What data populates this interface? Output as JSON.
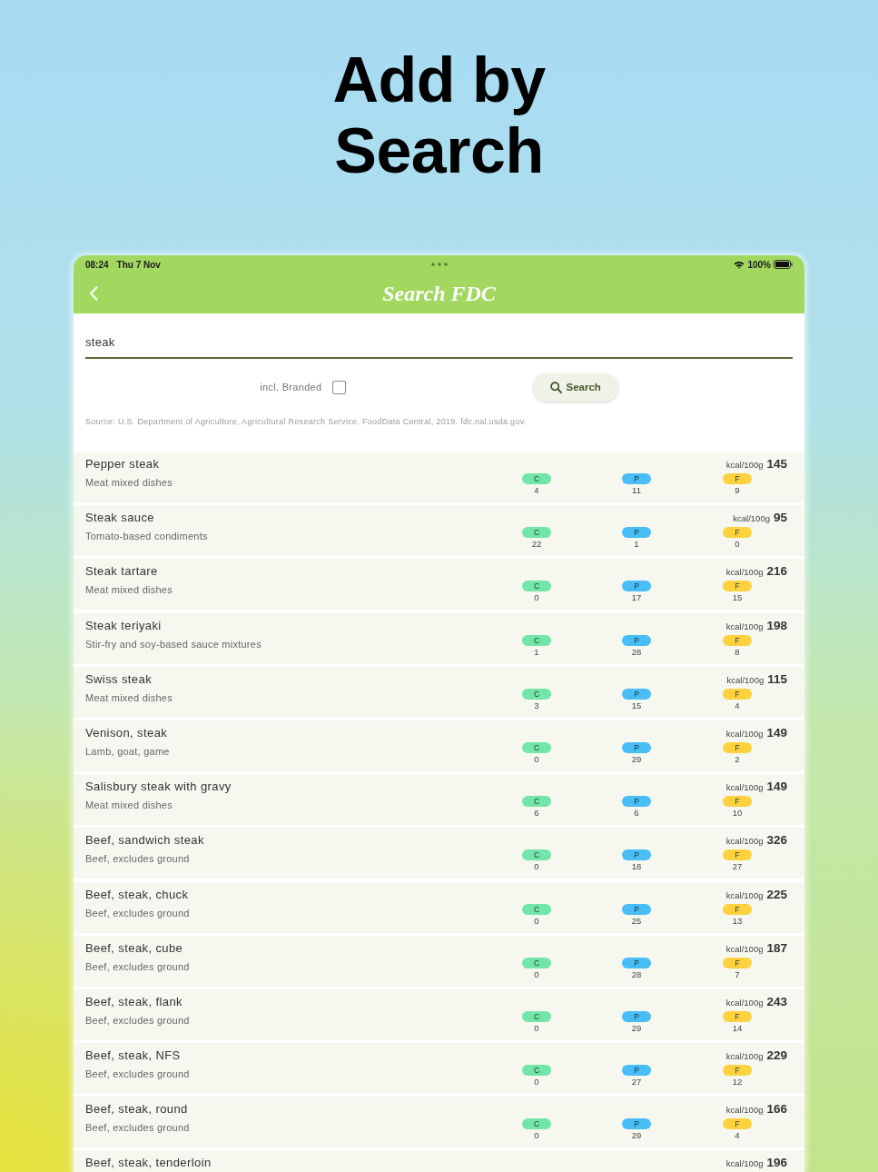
{
  "headline": "Add by Search",
  "status_bar": {
    "time": "08:24",
    "date": "Thu 7 Nov",
    "battery": "100%"
  },
  "nav": {
    "title": "Search FDC"
  },
  "search": {
    "value": "steak"
  },
  "branded": {
    "label": "incl. Branded",
    "checked": false
  },
  "search_button": {
    "label": "Search"
  },
  "source": "Source: U.S. Department of Agriculture, Agricultural Research Service. FoodData Central, 2019. fdc.nal.usda.gov.",
  "results": [
    {
      "name": "Pepper steak",
      "category": "Meat mixed dishes",
      "kcal_unit": "kcal/100g",
      "kcal": "145",
      "macros": [
        {
          "label": "C",
          "value": "4",
          "color": "#72e6a8"
        },
        {
          "label": "P",
          "value": "11",
          "color": "#48bdf6"
        },
        {
          "label": "F",
          "value": "9",
          "color": "#fdd23e"
        }
      ]
    },
    {
      "name": "Steak sauce",
      "category": "Tomato-based condiments",
      "kcal_unit": "kcal/100g",
      "kcal": "95",
      "macros": [
        {
          "label": "C",
          "value": "22",
          "color": "#72e6a8"
        },
        {
          "label": "P",
          "value": "1",
          "color": "#48bdf6"
        },
        {
          "label": "F",
          "value": "0",
          "color": "#fdd23e"
        }
      ]
    },
    {
      "name": "Steak tartare",
      "category": "Meat mixed dishes",
      "kcal_unit": "kcal/100g",
      "kcal": "216",
      "macros": [
        {
          "label": "C",
          "value": "0",
          "color": "#72e6a8"
        },
        {
          "label": "P",
          "value": "17",
          "color": "#48bdf6"
        },
        {
          "label": "F",
          "value": "15",
          "color": "#fdd23e"
        }
      ]
    },
    {
      "name": "Steak teriyaki",
      "category": "Stir-fry and soy-based sauce mixtures",
      "kcal_unit": "kcal/100g",
      "kcal": "198",
      "macros": [
        {
          "label": "C",
          "value": "1",
          "color": "#72e6a8"
        },
        {
          "label": "P",
          "value": "28",
          "color": "#48bdf6"
        },
        {
          "label": "F",
          "value": "8",
          "color": "#fdd23e"
        }
      ]
    },
    {
      "name": "Swiss steak",
      "category": "Meat mixed dishes",
      "kcal_unit": "kcal/100g",
      "kcal": "115",
      "macros": [
        {
          "label": "C",
          "value": "3",
          "color": "#72e6a8"
        },
        {
          "label": "P",
          "value": "15",
          "color": "#48bdf6"
        },
        {
          "label": "F",
          "value": "4",
          "color": "#fdd23e"
        }
      ]
    },
    {
      "name": "Venison, steak",
      "category": "Lamb, goat, game",
      "kcal_unit": "kcal/100g",
      "kcal": "149",
      "macros": [
        {
          "label": "C",
          "value": "0",
          "color": "#72e6a8"
        },
        {
          "label": "P",
          "value": "29",
          "color": "#48bdf6"
        },
        {
          "label": "F",
          "value": "2",
          "color": "#fdd23e"
        }
      ]
    },
    {
      "name": "Salisbury steak with gravy",
      "category": "Meat mixed dishes",
      "kcal_unit": "kcal/100g",
      "kcal": "149",
      "macros": [
        {
          "label": "C",
          "value": "6",
          "color": "#72e6a8"
        },
        {
          "label": "P",
          "value": "6",
          "color": "#48bdf6"
        },
        {
          "label": "F",
          "value": "10",
          "color": "#fdd23e"
        }
      ]
    },
    {
      "name": "Beef, sandwich steak",
      "category": "Beef, excludes ground",
      "kcal_unit": "kcal/100g",
      "kcal": "326",
      "macros": [
        {
          "label": "C",
          "value": "0",
          "color": "#72e6a8"
        },
        {
          "label": "P",
          "value": "18",
          "color": "#48bdf6"
        },
        {
          "label": "F",
          "value": "27",
          "color": "#fdd23e"
        }
      ]
    },
    {
      "name": "Beef, steak, chuck",
      "category": "Beef, excludes ground",
      "kcal_unit": "kcal/100g",
      "kcal": "225",
      "macros": [
        {
          "label": "C",
          "value": "0",
          "color": "#72e6a8"
        },
        {
          "label": "P",
          "value": "25",
          "color": "#48bdf6"
        },
        {
          "label": "F",
          "value": "13",
          "color": "#fdd23e"
        }
      ]
    },
    {
      "name": "Beef, steak, cube",
      "category": "Beef, excludes ground",
      "kcal_unit": "kcal/100g",
      "kcal": "187",
      "macros": [
        {
          "label": "C",
          "value": "0",
          "color": "#72e6a8"
        },
        {
          "label": "P",
          "value": "28",
          "color": "#48bdf6"
        },
        {
          "label": "F",
          "value": "7",
          "color": "#fdd23e"
        }
      ]
    },
    {
      "name": "Beef, steak, flank",
      "category": "Beef, excludes ground",
      "kcal_unit": "kcal/100g",
      "kcal": "243",
      "macros": [
        {
          "label": "C",
          "value": "0",
          "color": "#72e6a8"
        },
        {
          "label": "P",
          "value": "29",
          "color": "#48bdf6"
        },
        {
          "label": "F",
          "value": "14",
          "color": "#fdd23e"
        }
      ]
    },
    {
      "name": "Beef, steak, NFS",
      "category": "Beef, excludes ground",
      "kcal_unit": "kcal/100g",
      "kcal": "229",
      "macros": [
        {
          "label": "C",
          "value": "0",
          "color": "#72e6a8"
        },
        {
          "label": "P",
          "value": "27",
          "color": "#48bdf6"
        },
        {
          "label": "F",
          "value": "12",
          "color": "#fdd23e"
        }
      ]
    },
    {
      "name": "Beef, steak, round",
      "category": "Beef, excludes ground",
      "kcal_unit": "kcal/100g",
      "kcal": "166",
      "macros": [
        {
          "label": "C",
          "value": "0",
          "color": "#72e6a8"
        },
        {
          "label": "P",
          "value": "29",
          "color": "#48bdf6"
        },
        {
          "label": "F",
          "value": "4",
          "color": "#fdd23e"
        }
      ]
    },
    {
      "name": "Beef, steak, tenderloin",
      "kcal_unit": "kcal/100g",
      "kcal": "196"
    }
  ]
}
